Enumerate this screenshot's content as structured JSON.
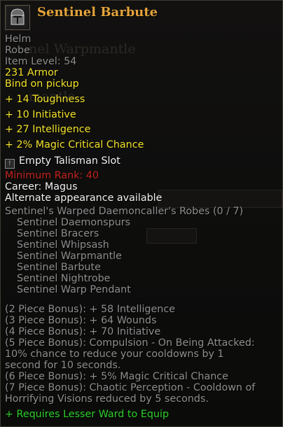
{
  "item": {
    "title": "Sentinel Barbute",
    "icon": "helm-icon",
    "slot_type": "Helm",
    "sub_type": "Robe",
    "item_level": "Item Level: 54",
    "armor": "231 Armor",
    "bind": "Bind on pickup",
    "stats": [
      "+ 14 Toughness",
      "+ 10 Initiative",
      "+ 27 Intelligence",
      "+ 2% Magic Critical Chance"
    ],
    "talisman_slot": "Empty Talisman Slot",
    "min_rank": "Minimum Rank: 40",
    "career": "Career: Magus",
    "alt_appearance": "Alternate appearance available",
    "set": {
      "name": "Sentinel's Warped Daemoncaller's Robes (0 / 7)",
      "pieces": [
        "Sentinel Daemonspurs",
        "Sentinel Bracers",
        "Sentinel Whipsash",
        "Sentinel Warpmantle",
        "Sentinel Barbute",
        "Sentinel Nightrobe",
        "Sentinel Warp Pendant"
      ],
      "bonuses": [
        "(2 Piece Bonus): + 58 Intelligence",
        "(3 Piece Bonus): + 64 Wounds",
        "(4 Piece Bonus): + 70 Initiative",
        "(5 Piece Bonus): Compulsion - On Being Attacked:",
        "10% chance to reduce your cooldowns by 1",
        "second for 10 seconds.",
        "(6 Piece Bonus): + 5% Magic Critical Chance",
        "(7 Piece Bonus): Chaotic Perception - Cooldown of",
        "Horrifying Visions reduced by 5 seconds."
      ]
    },
    "requirement": "+ Requires Lesser Ward to Equip"
  },
  "colors": {
    "title": "#e4a33b",
    "grey": "#8f8f8f",
    "stat": "#f3e32a",
    "rank_fail": "#c7261f",
    "requirement": "#2ed02b"
  }
}
